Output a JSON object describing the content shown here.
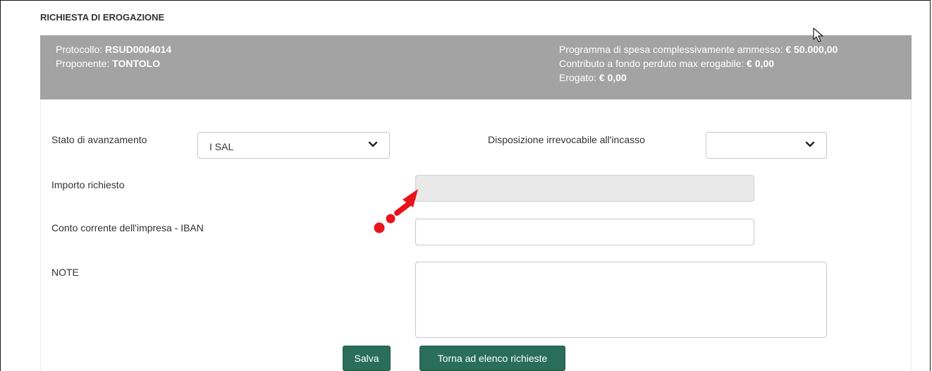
{
  "section_title": "RICHIESTA DI EROGAZIONE",
  "info": {
    "protocollo_label": "Protocollo: ",
    "protocollo_value": "RSUD0004014",
    "proponente_label": "Proponente: ",
    "proponente_value": "TONTOLO",
    "programma_label": "Programma di spesa complessivamente ammesso: ",
    "programma_value": "€ 50.000,00",
    "contributo_label": "Contributo a fondo perduto max erogabile: ",
    "contributo_value": "€ 0,00",
    "erogato_label": "Erogato: ",
    "erogato_value": "€ 0,00"
  },
  "form": {
    "stato_label": "Stato di avanzamento",
    "stato_value": "I SAL",
    "disposizione_label": "Disposizione irrevocabile all'incasso",
    "disposizione_value": "",
    "importo_label": "Importo richiesto",
    "importo_value": "",
    "iban_label": "Conto corrente dell'impresa - IBAN",
    "iban_value": "",
    "note_label": "NOTE",
    "note_value": ""
  },
  "buttons": {
    "salva": "Salva",
    "torna": "Torna ad elenco richieste"
  },
  "colors": {
    "info_bar": "#a3a3a3",
    "button": "#2a6e5a",
    "annotation": "#e8141b"
  },
  "icons": [
    "chevron-down-icon",
    "mouse-cursor-icon",
    "annotation-arrow-icon"
  ]
}
